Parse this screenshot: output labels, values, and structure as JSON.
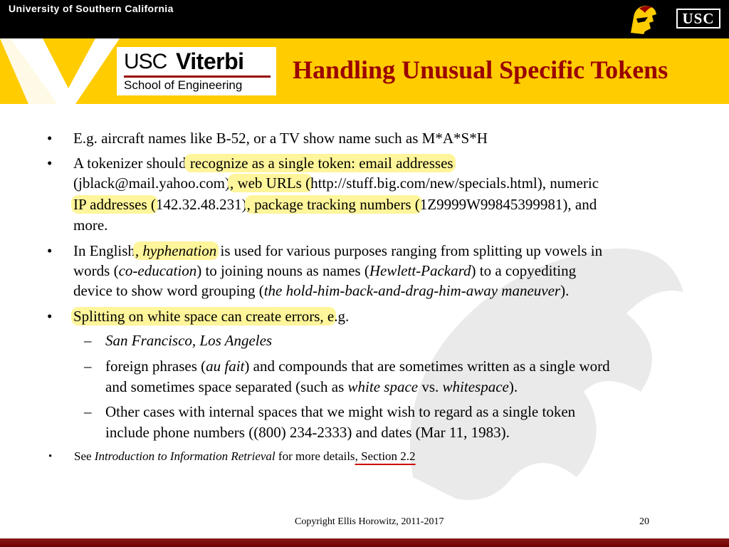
{
  "header": {
    "university": "University of Southern California",
    "usc_badge": "USC",
    "trojan_icon": "trojan-head-icon"
  },
  "banner": {
    "logo_usc": "USC",
    "logo_viterbi": "Viterbi",
    "logo_school": "School of Engineering",
    "title": "Handling Unusual Specific Tokens"
  },
  "colors": {
    "cardinal": "#990000",
    "gold": "#FFCC00",
    "highlight": "#FFF59A"
  },
  "bullets": {
    "b1": "E.g. aircraft names like B-52, or a TV show name such as M*A*S*H",
    "b2": {
      "l1a": "A tokenizer should",
      "l1b": " recognize as a single token: email addresses",
      "l2a": "(jblack@mail.yahoo.com)",
      "l2b": ", web URLs (",
      "l2c": "http://stuff.big.com/new/specials.html), numeric",
      "l3a": "IP addresses (",
      "l3b": "142.32.48.231)",
      "l3c": ", package tracking numbers (",
      "l3d": "1Z9999W99845399981), and",
      "l4": "more."
    },
    "b3": {
      "l1a": "In English",
      "l1b": ", hyphenation",
      "l1c": " is used for various purposes ranging from splitting up vowels in",
      "l2a": "words (",
      "l2b": "co-education",
      "l2c": ") to joining nouns as names (",
      "l2d": "Hewlett-Packard",
      "l2e": ") to a copyediting",
      "l3a": "device to show word grouping (",
      "l3b": "the hold-him-back-and-drag-him-away maneuver",
      "l3c": ")."
    },
    "b4": {
      "l1a": "Splitting on white space can create errors, e",
      "l1b": ".g."
    },
    "sub1": "San Francisco, Los Angeles",
    "sub2": {
      "l1a": "foreign phrases (",
      "l1b": "au fait",
      "l1c": ") and compounds that are sometimes written as a single word",
      "l2a": "and sometimes space separated (such as ",
      "l2b": "white space",
      "l2c": " vs. ",
      "l2d": "whitespace",
      "l2e": ")."
    },
    "sub3": {
      "l1": "Other cases with internal spaces that we might wish to regard as a single token",
      "l2": "include phone numbers ((800) 234-2333) and dates (Mar 11, 1983)."
    },
    "b5": {
      "a": "See ",
      "b": "Introduction to Information Retrieval",
      "c": " for more details",
      "d": ", Section 2.2"
    }
  },
  "footer": {
    "copyright": "Copyright Ellis Horowitz, 2011-2017",
    "page": "20"
  }
}
